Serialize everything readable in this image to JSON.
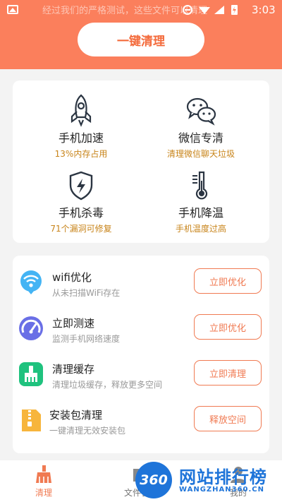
{
  "status_bar": {
    "notice": "经过我们的严格测试，这些文件可以清理",
    "time": "3:03"
  },
  "header": {
    "clean_button": "一键清理",
    "accent_color": "#fb7f5c"
  },
  "tools": [
    {
      "title": "手机加速",
      "subtitle": "13%内存占用",
      "icon": "rocket-icon"
    },
    {
      "title": "微信专清",
      "subtitle": "清理微信聊天垃圾",
      "icon": "wechat-icon"
    },
    {
      "title": "手机杀毒",
      "subtitle": "71个漏洞可修复",
      "icon": "shield-icon"
    },
    {
      "title": "手机降温",
      "subtitle": "手机温度过高",
      "icon": "thermometer-icon"
    }
  ],
  "list": [
    {
      "title": "wifi优化",
      "desc": "从未扫描WiFi存在",
      "button": "立即优化",
      "icon": "wifi-icon"
    },
    {
      "title": "立即测速",
      "desc": "监测手机网络速度",
      "button": "立即优化",
      "icon": "speedometer-icon"
    },
    {
      "title": "清理缓存",
      "desc": "清理垃圾缓存，释放更多空间",
      "button": "立即清理",
      "icon": "broom-icon"
    },
    {
      "title": "安装包清理",
      "desc": "一键清理无效安装包",
      "button": "释放空间",
      "icon": "zip-icon"
    }
  ],
  "nav": [
    {
      "label": "清理",
      "icon": "broom-icon",
      "active": true
    },
    {
      "label": "文件管理",
      "icon": "folder-icon",
      "active": false
    },
    {
      "label": "我的",
      "icon": "user-icon",
      "active": false
    }
  ],
  "watermark": {
    "badge": "360",
    "text": "网站排行榜",
    "sub": "WANGZHAN360.CN"
  }
}
